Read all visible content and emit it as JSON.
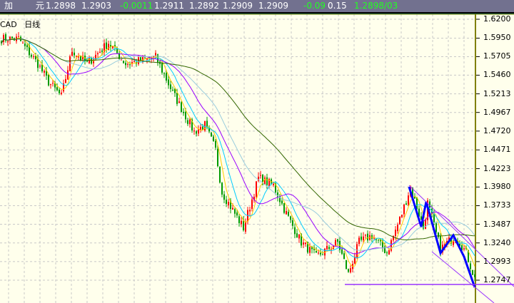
{
  "quote_bar": {
    "name": "加  元",
    "values": [
      {
        "text": "1.2898",
        "color": "#ffffff"
      },
      {
        "text": "1.2903",
        "color": "#ffffff"
      },
      {
        "text": "-0.0011",
        "color": "#22ff22"
      },
      {
        "text": "1.2911",
        "color": "#ffffff"
      },
      {
        "text": "1.2892",
        "color": "#ffffff"
      },
      {
        "text": "1.2909",
        "color": "#ffffff"
      },
      {
        "text": "1.2909",
        "color": "#ffffff"
      },
      {
        "text": "-0.09",
        "color": "#22ff22"
      },
      {
        "text": "0.15",
        "color": "#ffffff"
      },
      {
        "text": "1.2898/03",
        "color": "#22ff22"
      }
    ]
  },
  "chart_label": {
    "symbol": "CAD",
    "period": "日线"
  },
  "colors": {
    "bar_bg": "#72718f",
    "chart_bg": "#ffffec",
    "up": "#ff0000",
    "down": "#009900",
    "ma5": "#ffcc00",
    "ma10": "#00ccff",
    "ma20": "#9900ff",
    "ma30": "#99ccdd",
    "ma60": "#336600",
    "zigzag": "#0000ff",
    "channel": "#9933ff",
    "axis": "#808000"
  },
  "chart_data": {
    "type": "candlestick",
    "y_axis_ticks": [
      "1.6200",
      "1.5950",
      "1.5705",
      "1.5460",
      "1.5213",
      "1.4967",
      "1.4720",
      "1.4471",
      "1.4223",
      "1.3980",
      "1.3733",
      "1.3487",
      "1.3240",
      "1.2993",
      "1.2747"
    ],
    "ylim": [
      1.2747,
      1.62
    ],
    "grid": true,
    "close_path": [
      [
        0,
        1.594
      ],
      [
        8,
        1.594
      ],
      [
        17,
        1.561
      ],
      [
        22,
        1.537
      ],
      [
        28,
        1.518
      ],
      [
        33,
        1.579
      ],
      [
        40,
        1.561
      ],
      [
        50,
        1.589
      ],
      [
        58,
        1.561
      ],
      [
        72,
        1.57
      ],
      [
        80,
        1.523
      ],
      [
        90,
        1.471
      ],
      [
        95,
        1.48
      ],
      [
        100,
        1.447
      ],
      [
        103,
        1.391
      ],
      [
        113,
        1.344
      ],
      [
        120,
        1.41
      ],
      [
        127,
        1.4
      ],
      [
        133,
        1.363
      ],
      [
        140,
        1.325
      ],
      [
        147,
        1.306
      ],
      [
        157,
        1.325
      ],
      [
        162,
        1.283
      ],
      [
        167,
        1.325
      ],
      [
        173,
        1.334
      ],
      [
        180,
        1.311
      ],
      [
        187,
        1.363
      ],
      [
        191,
        1.398
      ],
      [
        197,
        1.344
      ],
      [
        199,
        1.377
      ],
      [
        205,
        1.316
      ],
      [
        212,
        1.334
      ],
      [
        217,
        1.311
      ],
      [
        222,
        1.268
      ]
    ],
    "indicators": [
      "MA5",
      "MA10",
      "MA20",
      "MA30",
      "MA60",
      "ZigZag",
      "trend channel"
    ]
  }
}
